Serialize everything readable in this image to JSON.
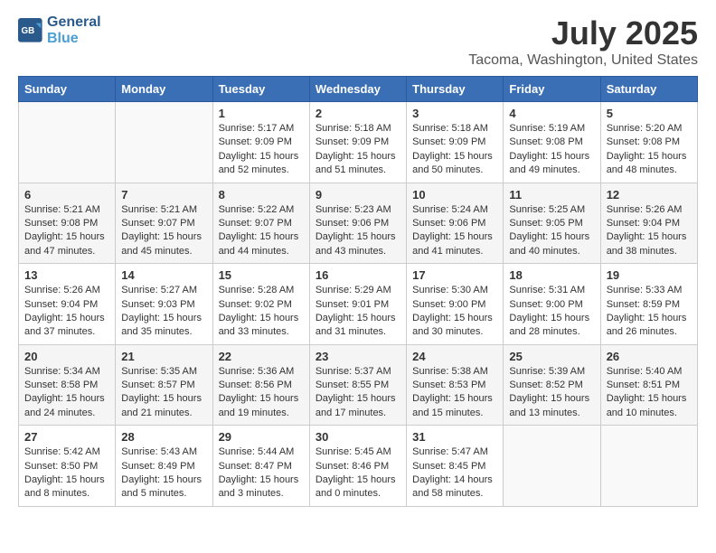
{
  "logo": {
    "line1": "General",
    "line2": "Blue"
  },
  "title": "July 2025",
  "subtitle": "Tacoma, Washington, United States",
  "days_header": [
    "Sunday",
    "Monday",
    "Tuesday",
    "Wednesday",
    "Thursday",
    "Friday",
    "Saturday"
  ],
  "weeks": [
    [
      {
        "num": "",
        "sunrise": "",
        "sunset": "",
        "daylight": ""
      },
      {
        "num": "",
        "sunrise": "",
        "sunset": "",
        "daylight": ""
      },
      {
        "num": "1",
        "sunrise": "Sunrise: 5:17 AM",
        "sunset": "Sunset: 9:09 PM",
        "daylight": "Daylight: 15 hours and 52 minutes."
      },
      {
        "num": "2",
        "sunrise": "Sunrise: 5:18 AM",
        "sunset": "Sunset: 9:09 PM",
        "daylight": "Daylight: 15 hours and 51 minutes."
      },
      {
        "num": "3",
        "sunrise": "Sunrise: 5:18 AM",
        "sunset": "Sunset: 9:09 PM",
        "daylight": "Daylight: 15 hours and 50 minutes."
      },
      {
        "num": "4",
        "sunrise": "Sunrise: 5:19 AM",
        "sunset": "Sunset: 9:08 PM",
        "daylight": "Daylight: 15 hours and 49 minutes."
      },
      {
        "num": "5",
        "sunrise": "Sunrise: 5:20 AM",
        "sunset": "Sunset: 9:08 PM",
        "daylight": "Daylight: 15 hours and 48 minutes."
      }
    ],
    [
      {
        "num": "6",
        "sunrise": "Sunrise: 5:21 AM",
        "sunset": "Sunset: 9:08 PM",
        "daylight": "Daylight: 15 hours and 47 minutes."
      },
      {
        "num": "7",
        "sunrise": "Sunrise: 5:21 AM",
        "sunset": "Sunset: 9:07 PM",
        "daylight": "Daylight: 15 hours and 45 minutes."
      },
      {
        "num": "8",
        "sunrise": "Sunrise: 5:22 AM",
        "sunset": "Sunset: 9:07 PM",
        "daylight": "Daylight: 15 hours and 44 minutes."
      },
      {
        "num": "9",
        "sunrise": "Sunrise: 5:23 AM",
        "sunset": "Sunset: 9:06 PM",
        "daylight": "Daylight: 15 hours and 43 minutes."
      },
      {
        "num": "10",
        "sunrise": "Sunrise: 5:24 AM",
        "sunset": "Sunset: 9:06 PM",
        "daylight": "Daylight: 15 hours and 41 minutes."
      },
      {
        "num": "11",
        "sunrise": "Sunrise: 5:25 AM",
        "sunset": "Sunset: 9:05 PM",
        "daylight": "Daylight: 15 hours and 40 minutes."
      },
      {
        "num": "12",
        "sunrise": "Sunrise: 5:26 AM",
        "sunset": "Sunset: 9:04 PM",
        "daylight": "Daylight: 15 hours and 38 minutes."
      }
    ],
    [
      {
        "num": "13",
        "sunrise": "Sunrise: 5:26 AM",
        "sunset": "Sunset: 9:04 PM",
        "daylight": "Daylight: 15 hours and 37 minutes."
      },
      {
        "num": "14",
        "sunrise": "Sunrise: 5:27 AM",
        "sunset": "Sunset: 9:03 PM",
        "daylight": "Daylight: 15 hours and 35 minutes."
      },
      {
        "num": "15",
        "sunrise": "Sunrise: 5:28 AM",
        "sunset": "Sunset: 9:02 PM",
        "daylight": "Daylight: 15 hours and 33 minutes."
      },
      {
        "num": "16",
        "sunrise": "Sunrise: 5:29 AM",
        "sunset": "Sunset: 9:01 PM",
        "daylight": "Daylight: 15 hours and 31 minutes."
      },
      {
        "num": "17",
        "sunrise": "Sunrise: 5:30 AM",
        "sunset": "Sunset: 9:00 PM",
        "daylight": "Daylight: 15 hours and 30 minutes."
      },
      {
        "num": "18",
        "sunrise": "Sunrise: 5:31 AM",
        "sunset": "Sunset: 9:00 PM",
        "daylight": "Daylight: 15 hours and 28 minutes."
      },
      {
        "num": "19",
        "sunrise": "Sunrise: 5:33 AM",
        "sunset": "Sunset: 8:59 PM",
        "daylight": "Daylight: 15 hours and 26 minutes."
      }
    ],
    [
      {
        "num": "20",
        "sunrise": "Sunrise: 5:34 AM",
        "sunset": "Sunset: 8:58 PM",
        "daylight": "Daylight: 15 hours and 24 minutes."
      },
      {
        "num": "21",
        "sunrise": "Sunrise: 5:35 AM",
        "sunset": "Sunset: 8:57 PM",
        "daylight": "Daylight: 15 hours and 21 minutes."
      },
      {
        "num": "22",
        "sunrise": "Sunrise: 5:36 AM",
        "sunset": "Sunset: 8:56 PM",
        "daylight": "Daylight: 15 hours and 19 minutes."
      },
      {
        "num": "23",
        "sunrise": "Sunrise: 5:37 AM",
        "sunset": "Sunset: 8:55 PM",
        "daylight": "Daylight: 15 hours and 17 minutes."
      },
      {
        "num": "24",
        "sunrise": "Sunrise: 5:38 AM",
        "sunset": "Sunset: 8:53 PM",
        "daylight": "Daylight: 15 hours and 15 minutes."
      },
      {
        "num": "25",
        "sunrise": "Sunrise: 5:39 AM",
        "sunset": "Sunset: 8:52 PM",
        "daylight": "Daylight: 15 hours and 13 minutes."
      },
      {
        "num": "26",
        "sunrise": "Sunrise: 5:40 AM",
        "sunset": "Sunset: 8:51 PM",
        "daylight": "Daylight: 15 hours and 10 minutes."
      }
    ],
    [
      {
        "num": "27",
        "sunrise": "Sunrise: 5:42 AM",
        "sunset": "Sunset: 8:50 PM",
        "daylight": "Daylight: 15 hours and 8 minutes."
      },
      {
        "num": "28",
        "sunrise": "Sunrise: 5:43 AM",
        "sunset": "Sunset: 8:49 PM",
        "daylight": "Daylight: 15 hours and 5 minutes."
      },
      {
        "num": "29",
        "sunrise": "Sunrise: 5:44 AM",
        "sunset": "Sunset: 8:47 PM",
        "daylight": "Daylight: 15 hours and 3 minutes."
      },
      {
        "num": "30",
        "sunrise": "Sunrise: 5:45 AM",
        "sunset": "Sunset: 8:46 PM",
        "daylight": "Daylight: 15 hours and 0 minutes."
      },
      {
        "num": "31",
        "sunrise": "Sunrise: 5:47 AM",
        "sunset": "Sunset: 8:45 PM",
        "daylight": "Daylight: 14 hours and 58 minutes."
      },
      {
        "num": "",
        "sunrise": "",
        "sunset": "",
        "daylight": ""
      },
      {
        "num": "",
        "sunrise": "",
        "sunset": "",
        "daylight": ""
      }
    ]
  ]
}
